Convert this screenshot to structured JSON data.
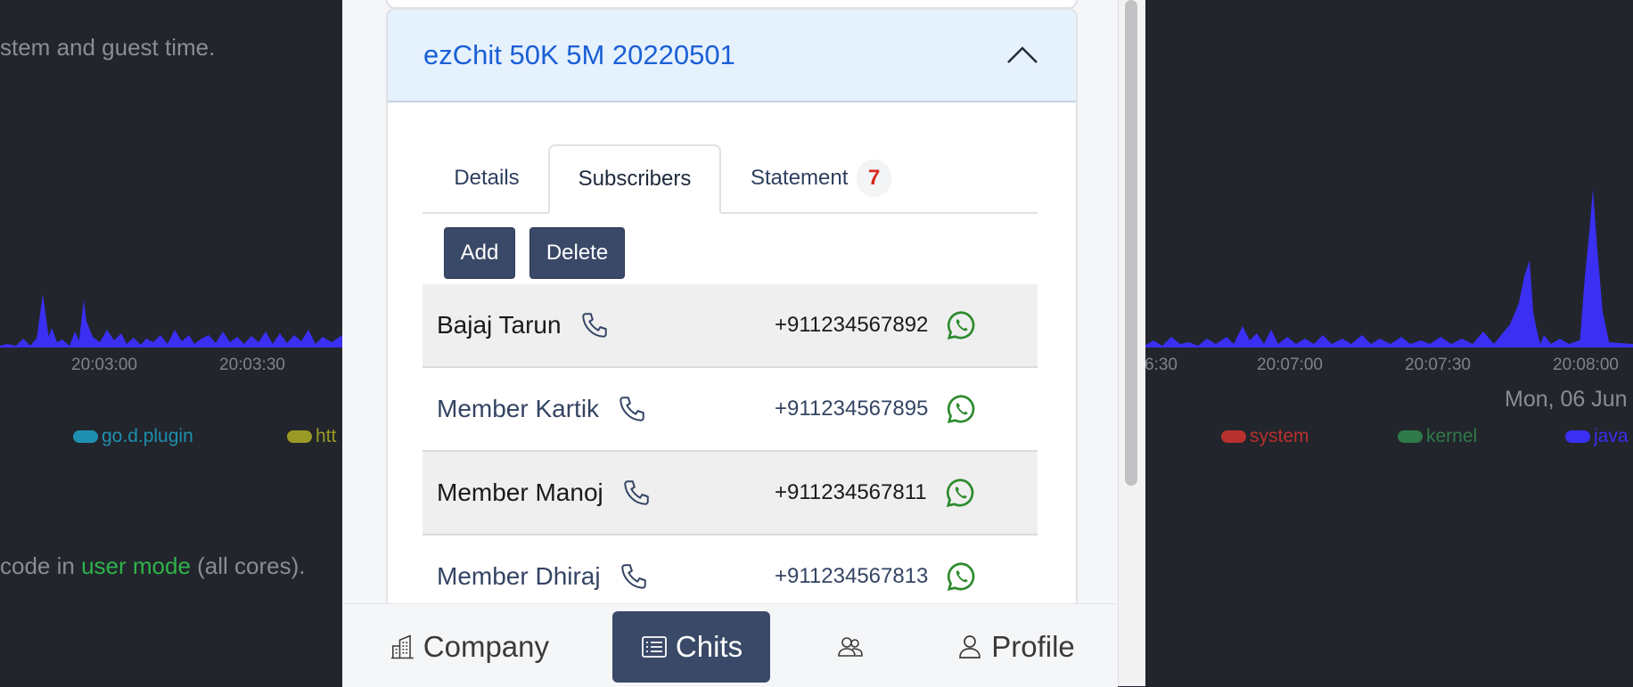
{
  "background": {
    "desc_top": "stem and guest time.",
    "desc_bottom_prefix": "code in ",
    "desc_bottom_highlight": "user mode",
    "desc_bottom_suffix": " (all cores).",
    "ticks_left": [
      "20:03:00",
      "20:03:30"
    ],
    "ticks_right": [
      "6:30",
      "20:07:00",
      "20:07:30",
      "20:08:00"
    ],
    "date_label": "Mon, 06 Jun",
    "legend_left": [
      {
        "label": "go.d.plugin",
        "color": "#1f8fb1"
      },
      {
        "label": "htt",
        "color": "#9a9a26"
      }
    ],
    "legend_right": [
      {
        "label": "system",
        "color": "#b8312f"
      },
      {
        "label": "kernel",
        "color": "#2e7a4a"
      },
      {
        "label": "java",
        "color": "#3a2ff2"
      }
    ],
    "accent_area": "#3a2ff2"
  },
  "chit": {
    "title": "ezChit 50K 5M 20220501",
    "tabs": [
      {
        "label": "Details"
      },
      {
        "label": "Subscribers"
      },
      {
        "label": "Statement",
        "badge": "7"
      }
    ],
    "actions": {
      "add": "Add",
      "delete": "Delete"
    },
    "subscribers": [
      {
        "name": "Bajaj Tarun",
        "phone": "+911234567892"
      },
      {
        "name": "Member Kartik",
        "phone": "+911234567895"
      },
      {
        "name": "Member Manoj",
        "phone": "+911234567811"
      },
      {
        "name": "Member Dhiraj",
        "phone": "+911234567813"
      }
    ]
  },
  "nav": {
    "company": "Company",
    "chits": "Chits",
    "profile": "Profile"
  },
  "colors": {
    "primary": "#3a4968",
    "link": "#1a5fd6",
    "badge": "#d6271c",
    "whatsapp": "#2e8b2e"
  }
}
